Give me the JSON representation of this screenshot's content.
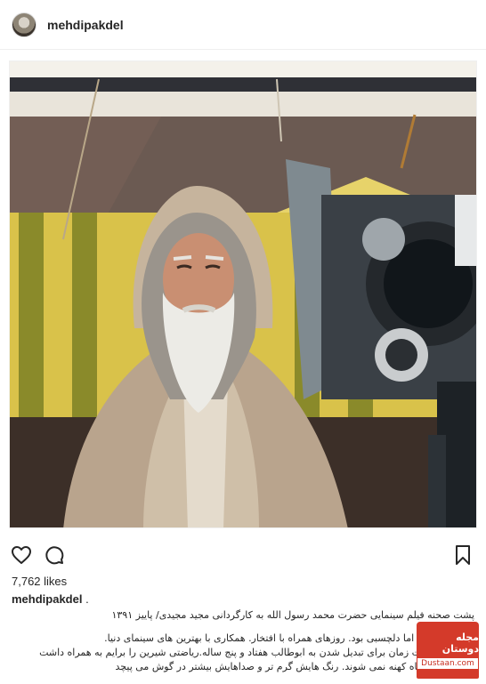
{
  "header": {
    "username": "mehdipakdel"
  },
  "post": {
    "likes": "7,762 likes",
    "caption_user": "mehdipakdel",
    "caption_user_suffix": " .",
    "caption_lines": [
      "پشت صحنه فیلم سینمایی حضرت محمد رسول الله به کارگردانی مجید مجیدی/ پاییز ۱۳۹۱",
      "روزهای سخت اما دلچسبی بود. روزهای همراه با افتخار. همکاری با بهترین های سینمای دنیا.",
      "حدود ده ساعت زمان برای تبدیل شدن به ابوطالب هفتاد و پنج ساله.ریاضتی شیرین را برایم به همراه داشت",
      "خاطرات هیچگاه کهنه نمی شوند. رنگ هایش گرم تر و صداهایش بیشتر در گوش می پیچد"
    ]
  },
  "watermark": {
    "brand": "مجله دوستان",
    "domain": "Dustaan.com"
  },
  "icons": {
    "like": "heart-icon",
    "comment": "comment-icon",
    "save": "bookmark-icon"
  }
}
